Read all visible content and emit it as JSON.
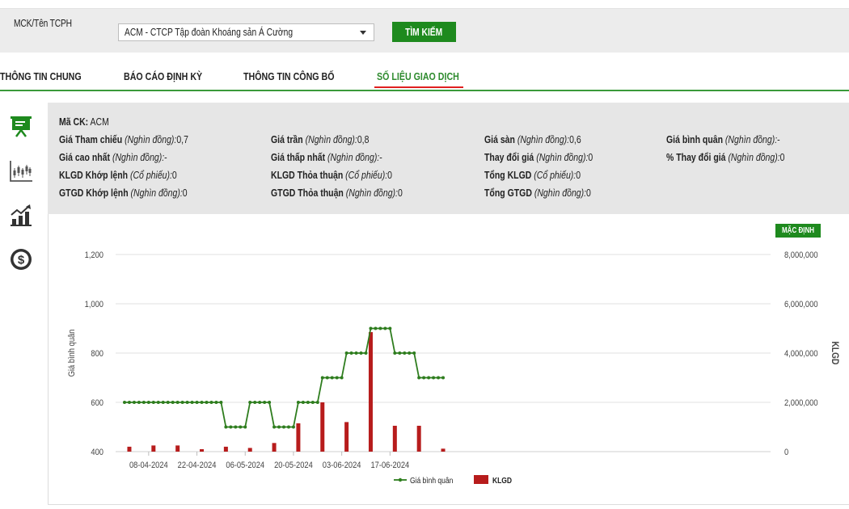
{
  "search": {
    "label": "MCK/Tên TCPH",
    "selected": "ACM - CTCP Tập đoàn Khoáng sản Á Cường",
    "button": "TÌM KIẾM"
  },
  "tabs": [
    {
      "label": "THÔNG TIN CHUNG"
    },
    {
      "label": "BÁO CÁO ĐỊNH KỲ"
    },
    {
      "label": "THÔNG TIN CÔNG BỐ"
    },
    {
      "label": "SỐ LIỆU GIAO DỊCH"
    }
  ],
  "sidebar_icons": [
    "presentation-icon",
    "candlestick-chart-icon",
    "bar-chart-icon",
    "dollar-icon"
  ],
  "info": {
    "code_label": "Mã CK:",
    "code_value": "ACM",
    "rows": [
      [
        {
          "label": "Giá Tham chiếu",
          "unit": "(Nghìn đồng):",
          "value": "0,7"
        },
        {
          "label": "Giá trần",
          "unit": "(Nghìn đồng):",
          "value": "0,8"
        },
        {
          "label": "Giá sàn",
          "unit": "(Nghìn đồng):",
          "value": "0,6"
        },
        {
          "label": "Giá bình quân",
          "unit": "(Nghìn đồng):",
          "value": "-"
        }
      ],
      [
        {
          "label": "Giá cao nhất",
          "unit": "(Nghìn đồng):",
          "value": "-"
        },
        {
          "label": "Giá thấp nhất",
          "unit": "(Nghìn đồng):",
          "value": "-"
        },
        {
          "label": "Thay đổi giá",
          "unit": "(Nghìn đồng):",
          "value": "0"
        },
        {
          "label": "% Thay đổi giá",
          "unit": "(Nghìn đồng):",
          "value": "0"
        }
      ],
      [
        {
          "label": "KLGD Khớp lệnh",
          "unit": "(Cổ phiếu):",
          "value": "0"
        },
        {
          "label": "KLGD Thỏa thuận",
          "unit": "(Cổ phiếu):",
          "value": "0"
        },
        {
          "label": "Tổng KLGD",
          "unit": "(Cổ phiếu):",
          "value": "0"
        }
      ],
      [
        {
          "label": "GTGD Khớp lệnh",
          "unit": "(Nghìn đồng):",
          "value": "0"
        },
        {
          "label": "GTGD Thỏa thuận",
          "unit": "(Nghìn đồng):",
          "value": "0"
        },
        {
          "label": "Tổng GTGD",
          "unit": "(Nghìn đồng):",
          "value": "0"
        }
      ]
    ]
  },
  "default_button": "MẶC ĐỊNH",
  "colors": {
    "accent": "#1e8a1e",
    "line": "#2e7d1e",
    "bar": "#b71c1c",
    "active_underline": "#e02020"
  },
  "chart_data": {
    "type": "line+bar",
    "x_tick_labels": [
      "08-04-2024",
      "22-04-2024",
      "06-05-2024",
      "20-05-2024",
      "03-06-2024",
      "17-06-2024"
    ],
    "x_tick_indices": [
      5,
      15,
      25,
      35,
      45,
      55
    ],
    "ylabel_left": "Giá bình quân",
    "ylabel_right": "KLGD",
    "yticks_left": [
      "1,200",
      "1,000",
      "800",
      "600",
      "400"
    ],
    "yticks_right": [
      "8,000,000",
      "6,000,000",
      "4,000,000",
      "2,000,000",
      "0"
    ],
    "ylim_left": [
      400,
      1200
    ],
    "ylim_right": [
      0,
      8000000
    ],
    "legend": [
      "Giá bình quân",
      "KLGD"
    ],
    "legend_position": "bottom",
    "n_points": 67,
    "price_segments": [
      {
        "from": 0,
        "to": 20,
        "value": 600
      },
      {
        "from": 21,
        "to": 25,
        "value": 500
      },
      {
        "from": 26,
        "to": 30,
        "value": 600
      },
      {
        "from": 31,
        "to": 35,
        "value": 500
      },
      {
        "from": 36,
        "to": 40,
        "value": 600
      },
      {
        "from": 41,
        "to": 45,
        "value": 700
      },
      {
        "from": 46,
        "to": 50,
        "value": 800
      },
      {
        "from": 51,
        "to": 55,
        "value": 900
      },
      {
        "from": 56,
        "to": 60,
        "value": 800
      },
      {
        "from": 61,
        "to": 66,
        "value": 700
      }
    ],
    "volume_bars": [
      {
        "index": 1,
        "value": 200000
      },
      {
        "index": 6,
        "value": 250000
      },
      {
        "index": 11,
        "value": 250000
      },
      {
        "index": 16,
        "value": 100000
      },
      {
        "index": 21,
        "value": 200000
      },
      {
        "index": 26,
        "value": 150000
      },
      {
        "index": 31,
        "value": 350000
      },
      {
        "index": 36,
        "value": 1150000
      },
      {
        "index": 41,
        "value": 2000000
      },
      {
        "index": 46,
        "value": 1200000
      },
      {
        "index": 51,
        "value": 4850000
      },
      {
        "index": 56,
        "value": 1050000
      },
      {
        "index": 61,
        "value": 1050000
      },
      {
        "index": 66,
        "value": 120000
      }
    ]
  }
}
